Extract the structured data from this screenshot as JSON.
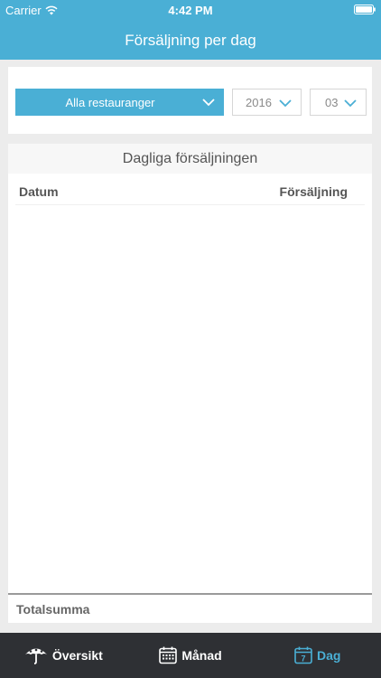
{
  "status_bar": {
    "carrier": "Carrier",
    "time": "4:42 PM"
  },
  "nav": {
    "title": "Försäljning per dag"
  },
  "filters": {
    "restaurant": "Alla restauranger",
    "year": "2016",
    "month": "03"
  },
  "table": {
    "title": "Dagliga försäljningen",
    "columns": [
      "Datum",
      "Försäljning"
    ],
    "rows": [],
    "total_label": "Totalsumma"
  },
  "tabs": [
    {
      "label": "Översikt",
      "icon": "umbrella-icon",
      "active": false
    },
    {
      "label": "Månad",
      "icon": "calendar-grid-icon",
      "active": false
    },
    {
      "label": "Dag",
      "icon": "calendar-day-icon",
      "active": true,
      "day_number": "7"
    }
  ],
  "colors": {
    "accent": "#4aafd5",
    "tab_bar": "#2e3034",
    "background": "#ececec"
  }
}
